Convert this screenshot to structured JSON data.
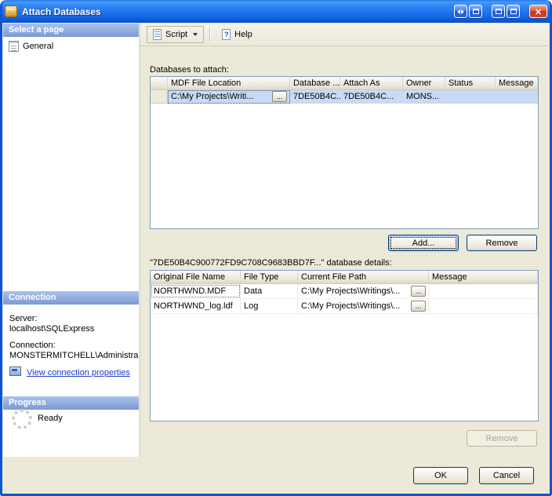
{
  "titlebar": {
    "title": "Attach Databases"
  },
  "colors": {
    "titlebar_blue": "#1464e4",
    "window_frame": "#0b55d6",
    "panel_header_blue": "#7d99d4",
    "selection_blue": "#c8daf4",
    "link_blue": "#1f3bd0",
    "dialog_background": "#ece9d8"
  },
  "icons": {
    "window_icon": "attach-database-icon",
    "titlebar_buttons": [
      "float-window-icon",
      "dock-window-icon",
      "minimize-icon",
      "maximize-icon",
      "close-icon"
    ],
    "general_page": "page-properties-icon",
    "script": "script-icon",
    "help": "help-icon",
    "connection_link": "connection-properties-icon",
    "progress": "progress-spinner-icon"
  },
  "sidebar": {
    "pages_header": "Select a page",
    "general_label": "General",
    "connection_header": "Connection",
    "server_label": "Server:",
    "server_value": "localhost\\SQLExpress",
    "connection_label": "Connection:",
    "connection_value": "MONSTERMITCHELL\\Administra",
    "connection_link": "View connection properties",
    "progress_header": "Progress",
    "progress_status": "Ready"
  },
  "toolbar": {
    "script_label": "Script",
    "help_label": "Help"
  },
  "main": {
    "attach_label": "Databases to attach:",
    "attach_table": {
      "headers": [
        "",
        "MDF File Location",
        "Database ...",
        "Attach As",
        "Owner",
        "Status",
        "Message"
      ],
      "rows": [
        {
          "mdf_file_location": "C:\\My Projects\\Writi...",
          "browse": "...",
          "database": "7DE50B4C...",
          "attach_as": "7DE50B4C...",
          "owner": "MONS...",
          "status": "",
          "message": ""
        }
      ]
    },
    "add_button": "Add...",
    "remove_button": "Remove",
    "details_label": "\"7DE50B4C900772FD9C708C9683BBD7F...\" database details:",
    "details_table": {
      "headers": [
        "Original File Name",
        "File Type",
        "Current File Path",
        "Message"
      ],
      "rows": [
        {
          "original_file_name": "NORTHWND.MDF",
          "file_type": "Data",
          "current_file_path": "C:\\My Projects\\Writings\\...",
          "browse": "...",
          "message": ""
        },
        {
          "original_file_name": "NORTHWND_log.ldf",
          "file_type": "Log",
          "current_file_path": "C:\\My Projects\\Writings\\...",
          "browse": "...",
          "message": ""
        }
      ]
    },
    "details_remove_button": "Remove"
  },
  "footer": {
    "ok_button": "OK",
    "cancel_button": "Cancel"
  }
}
